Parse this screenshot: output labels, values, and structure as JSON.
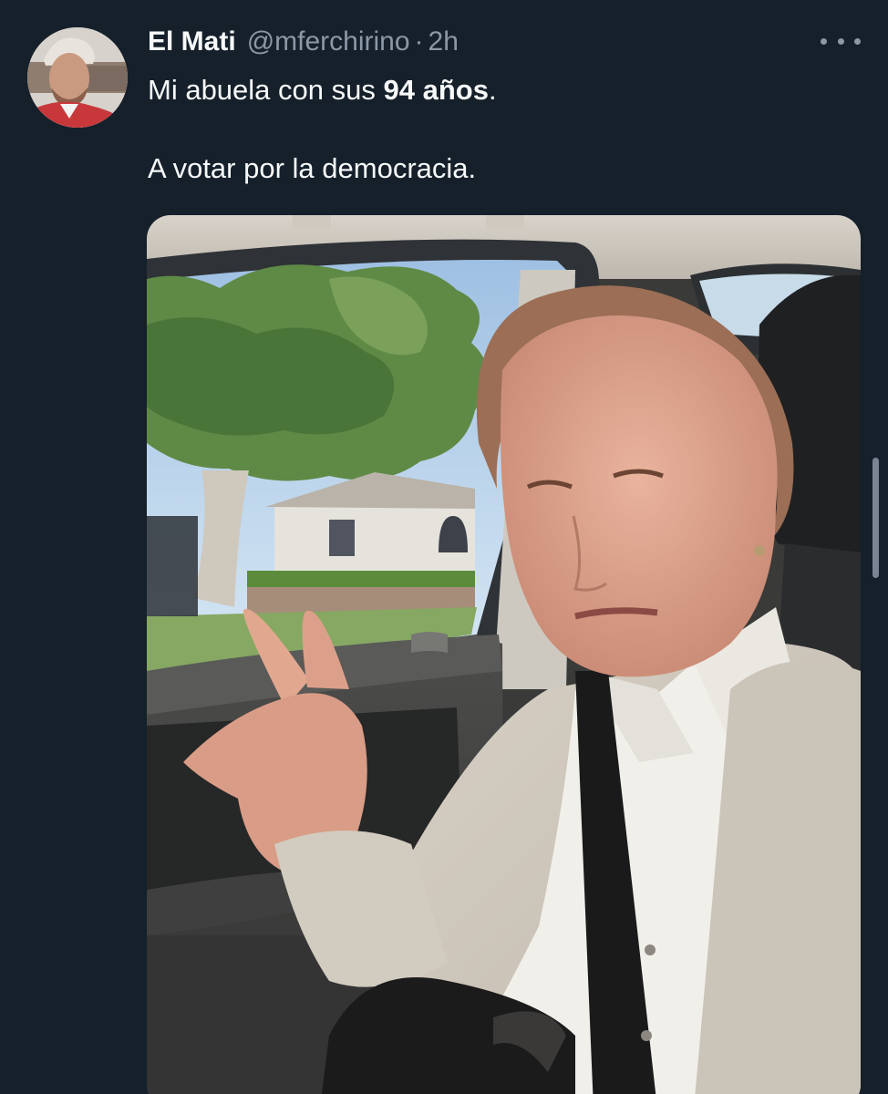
{
  "tweet": {
    "author_name": "El Mati",
    "author_handle": "@mferchirino",
    "separator": "·",
    "time": "2h",
    "text_line1_start": "Mi abuela con sus ",
    "text_line1_bold": "94 años",
    "text_line1_end": ".",
    "text_line2": "A votar por la democracia."
  },
  "icons": {
    "more": "more-horizontal-icon"
  },
  "colors": {
    "background": "#15202b",
    "primary_text": "#f7f9f9",
    "secondary_text": "#8b98a5"
  }
}
